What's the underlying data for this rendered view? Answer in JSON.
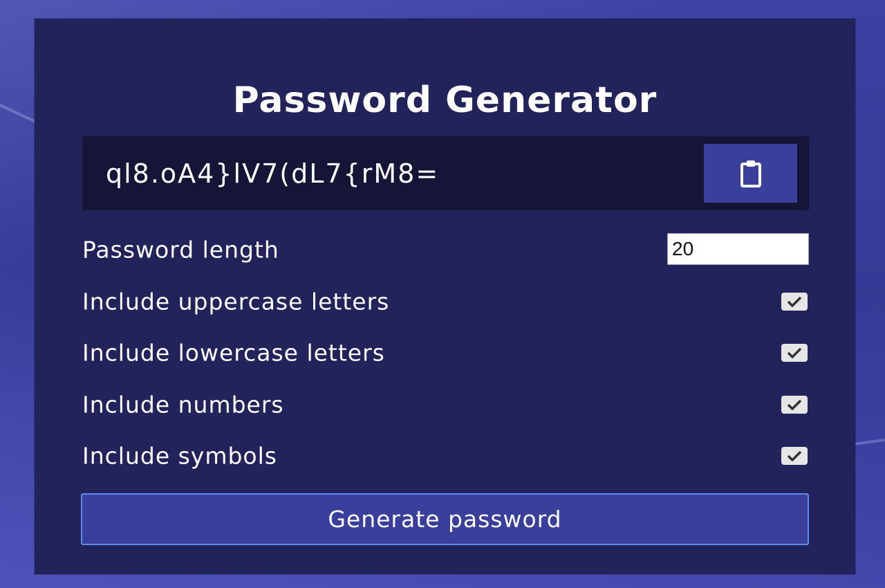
{
  "app": {
    "title": "Password Generator"
  },
  "result": {
    "password": "ql8.oA4}lV7(dL7{rM8=",
    "copy_icon": "clipboard-icon"
  },
  "settings": {
    "length_label": "Password length",
    "length_value": "20",
    "options": [
      {
        "label": "Include uppercase letters",
        "checked": true
      },
      {
        "label": "Include lowercase letters",
        "checked": true
      },
      {
        "label": "Include numbers",
        "checked": true
      },
      {
        "label": "Include symbols",
        "checked": true
      }
    ]
  },
  "actions": {
    "generate_label": "Generate password"
  },
  "colors": {
    "page_bg": "#3b3f9c",
    "card_bg": "#23235b",
    "result_bg": "#141537",
    "button_bg": "#3b3f9c",
    "button_border": "#5c8cf0"
  }
}
